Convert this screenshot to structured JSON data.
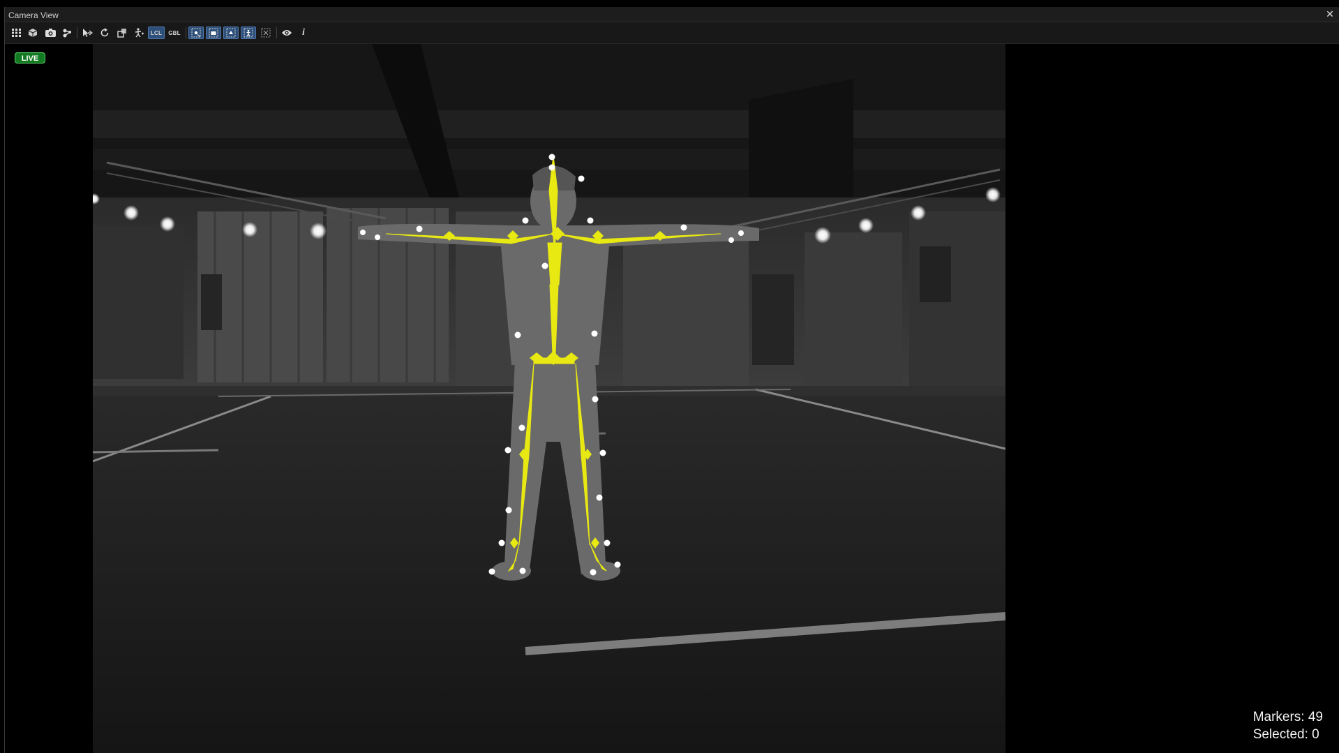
{
  "window": {
    "title": "Camera View",
    "close_glyph": "✕"
  },
  "toolbar": {
    "buttons": [
      {
        "icon": "grid-icon",
        "glyph": "▦"
      },
      {
        "icon": "cube-icon",
        "glyph": "⬢"
      },
      {
        "icon": "camera-icon",
        "glyph": "◙"
      },
      {
        "icon": "nodes-icon",
        "glyph": "⚘"
      },
      {
        "icon": "move-icon",
        "glyph": "✥"
      },
      {
        "icon": "rotate-icon",
        "glyph": "↻"
      },
      {
        "icon": "scale-icon",
        "glyph": "◱"
      },
      {
        "icon": "skeleton-pose-icon",
        "glyph": "⚛"
      },
      {
        "icon": "local-space-toggle",
        "label": "LCL",
        "active": true
      },
      {
        "icon": "global-space-toggle",
        "label": "GBL",
        "active": false
      },
      {
        "icon": "select-markers-icon",
        "glyph": "▣",
        "active": true
      },
      {
        "icon": "select-cameras-icon",
        "glyph": "▣",
        "active": true
      },
      {
        "icon": "select-rigid-bodies-icon",
        "glyph": "▣",
        "active": true
      },
      {
        "icon": "select-skeletons-icon",
        "glyph": "▣",
        "active": true
      },
      {
        "icon": "select-other-icon",
        "glyph": "⬚",
        "active": false
      },
      {
        "icon": "visibility-icon",
        "glyph": "◉"
      },
      {
        "icon": "info-icon",
        "glyph": "i"
      }
    ]
  },
  "viewport": {
    "live_label": "LIVE",
    "markers_label": "Markers: 49",
    "selected_label": "Selected: 0"
  },
  "colors": {
    "skeleton": "#e8e812",
    "live_green": "#137a22",
    "marker": "#ffffff"
  }
}
